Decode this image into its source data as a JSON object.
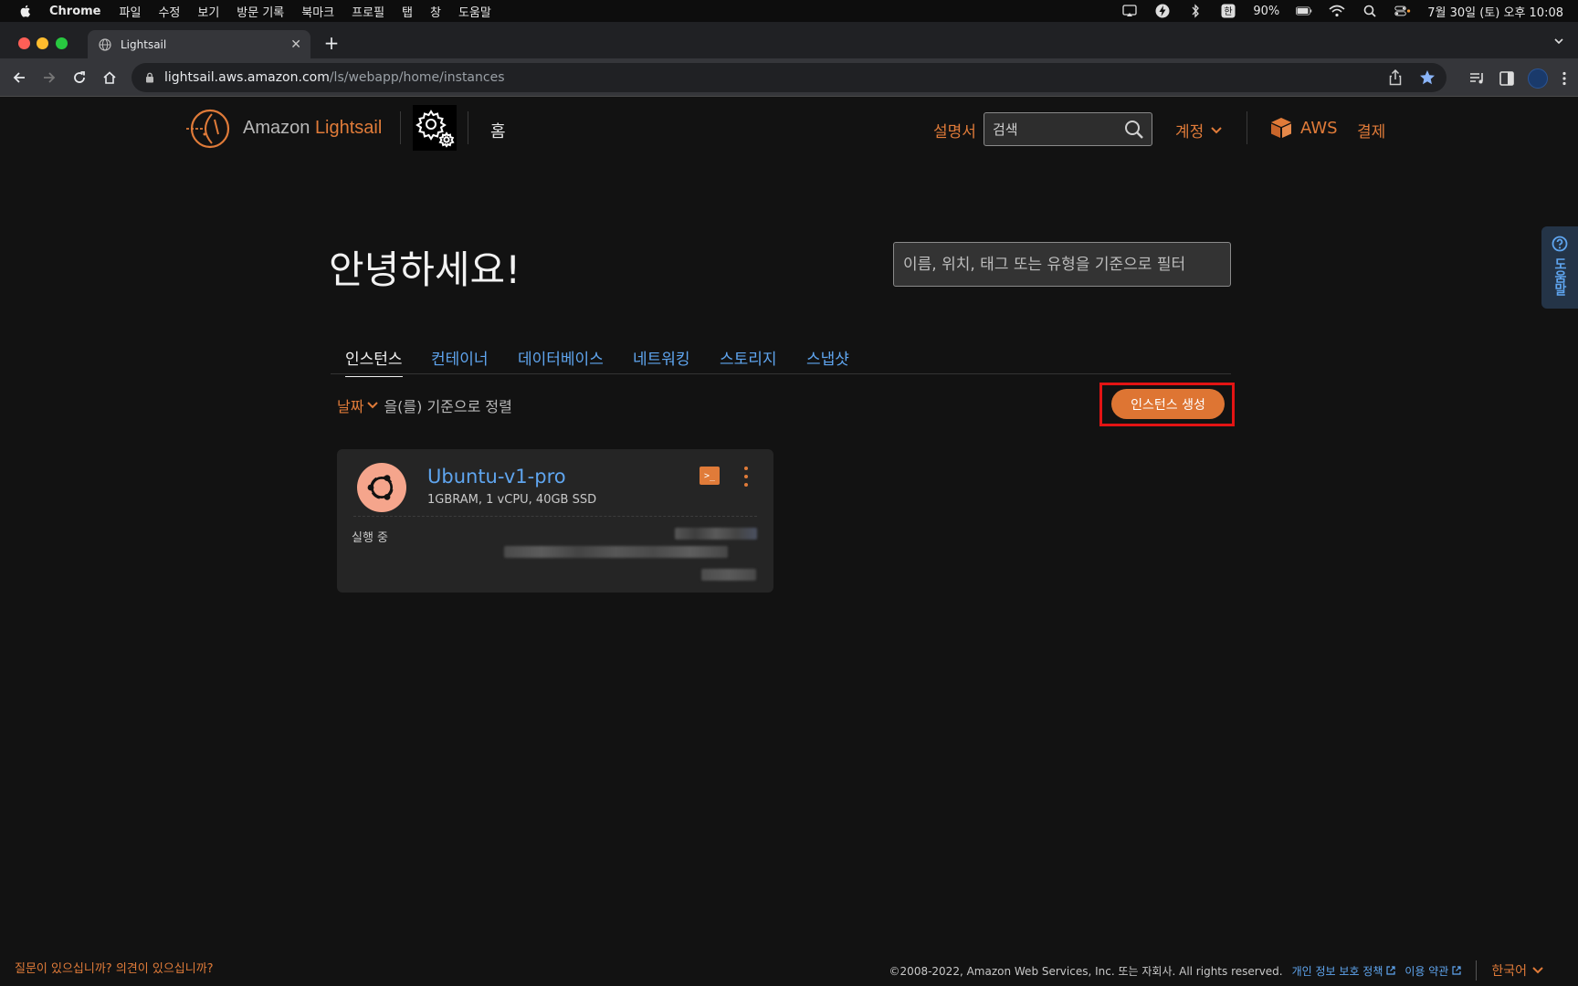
{
  "menubar": {
    "app_name": "Chrome",
    "items": [
      "파일",
      "수정",
      "보기",
      "방문 기록",
      "북마크",
      "프로필",
      "탭",
      "창",
      "도움말"
    ],
    "battery": "90%",
    "datetime": "7월 30일 (토) 오후 10:08"
  },
  "browser": {
    "tab_title": "Lightsail",
    "new_tab": "+",
    "tab_close": "✕",
    "url_host": "lightsail.aws.amazon.com",
    "url_path": "/ls/webapp/home/instances"
  },
  "header": {
    "brand_prefix": "Amazon ",
    "brand_name": "Lightsail",
    "home": "홈",
    "docs": "설명서",
    "search_value": "검색",
    "account": "계정",
    "aws": "AWS",
    "billing": "결제"
  },
  "main": {
    "greeting": "안녕하세요!",
    "filter_placeholder": "이름, 위치, 태그 또는 유형을 기준으로 필터",
    "tabs": [
      {
        "label": "인스턴스",
        "active": true
      },
      {
        "label": "컨테이너",
        "active": false
      },
      {
        "label": "데이터베이스",
        "active": false
      },
      {
        "label": "네트워킹",
        "active": false
      },
      {
        "label": "스토리지",
        "active": false
      },
      {
        "label": "스냅샷",
        "active": false
      }
    ],
    "sort_key": "날짜",
    "sort_suffix": "을(를) 기준으로 정렬",
    "create_button": "인스턴스 생성"
  },
  "instance": {
    "name": "Ubuntu-v1-pro",
    "spec": "1GBRAM, 1 vCPU, 40GB SSD",
    "status": "실행 중",
    "terminal_glyph": ">_"
  },
  "help": {
    "label": "도움말"
  },
  "footer": {
    "question": "질문이 있으십니까? 의견이 있으십니까?",
    "copyright": "©2008-2022, Amazon Web Services, Inc. 또는 자회사. All rights reserved.",
    "privacy": "개인 정보 보호 정책",
    "terms": "이용 약관",
    "language": "한국어"
  },
  "colors": {
    "accent_orange": "#e07b39",
    "link_blue": "#5fa5ef",
    "background": "#121212",
    "highlight_red": "#e31414"
  }
}
